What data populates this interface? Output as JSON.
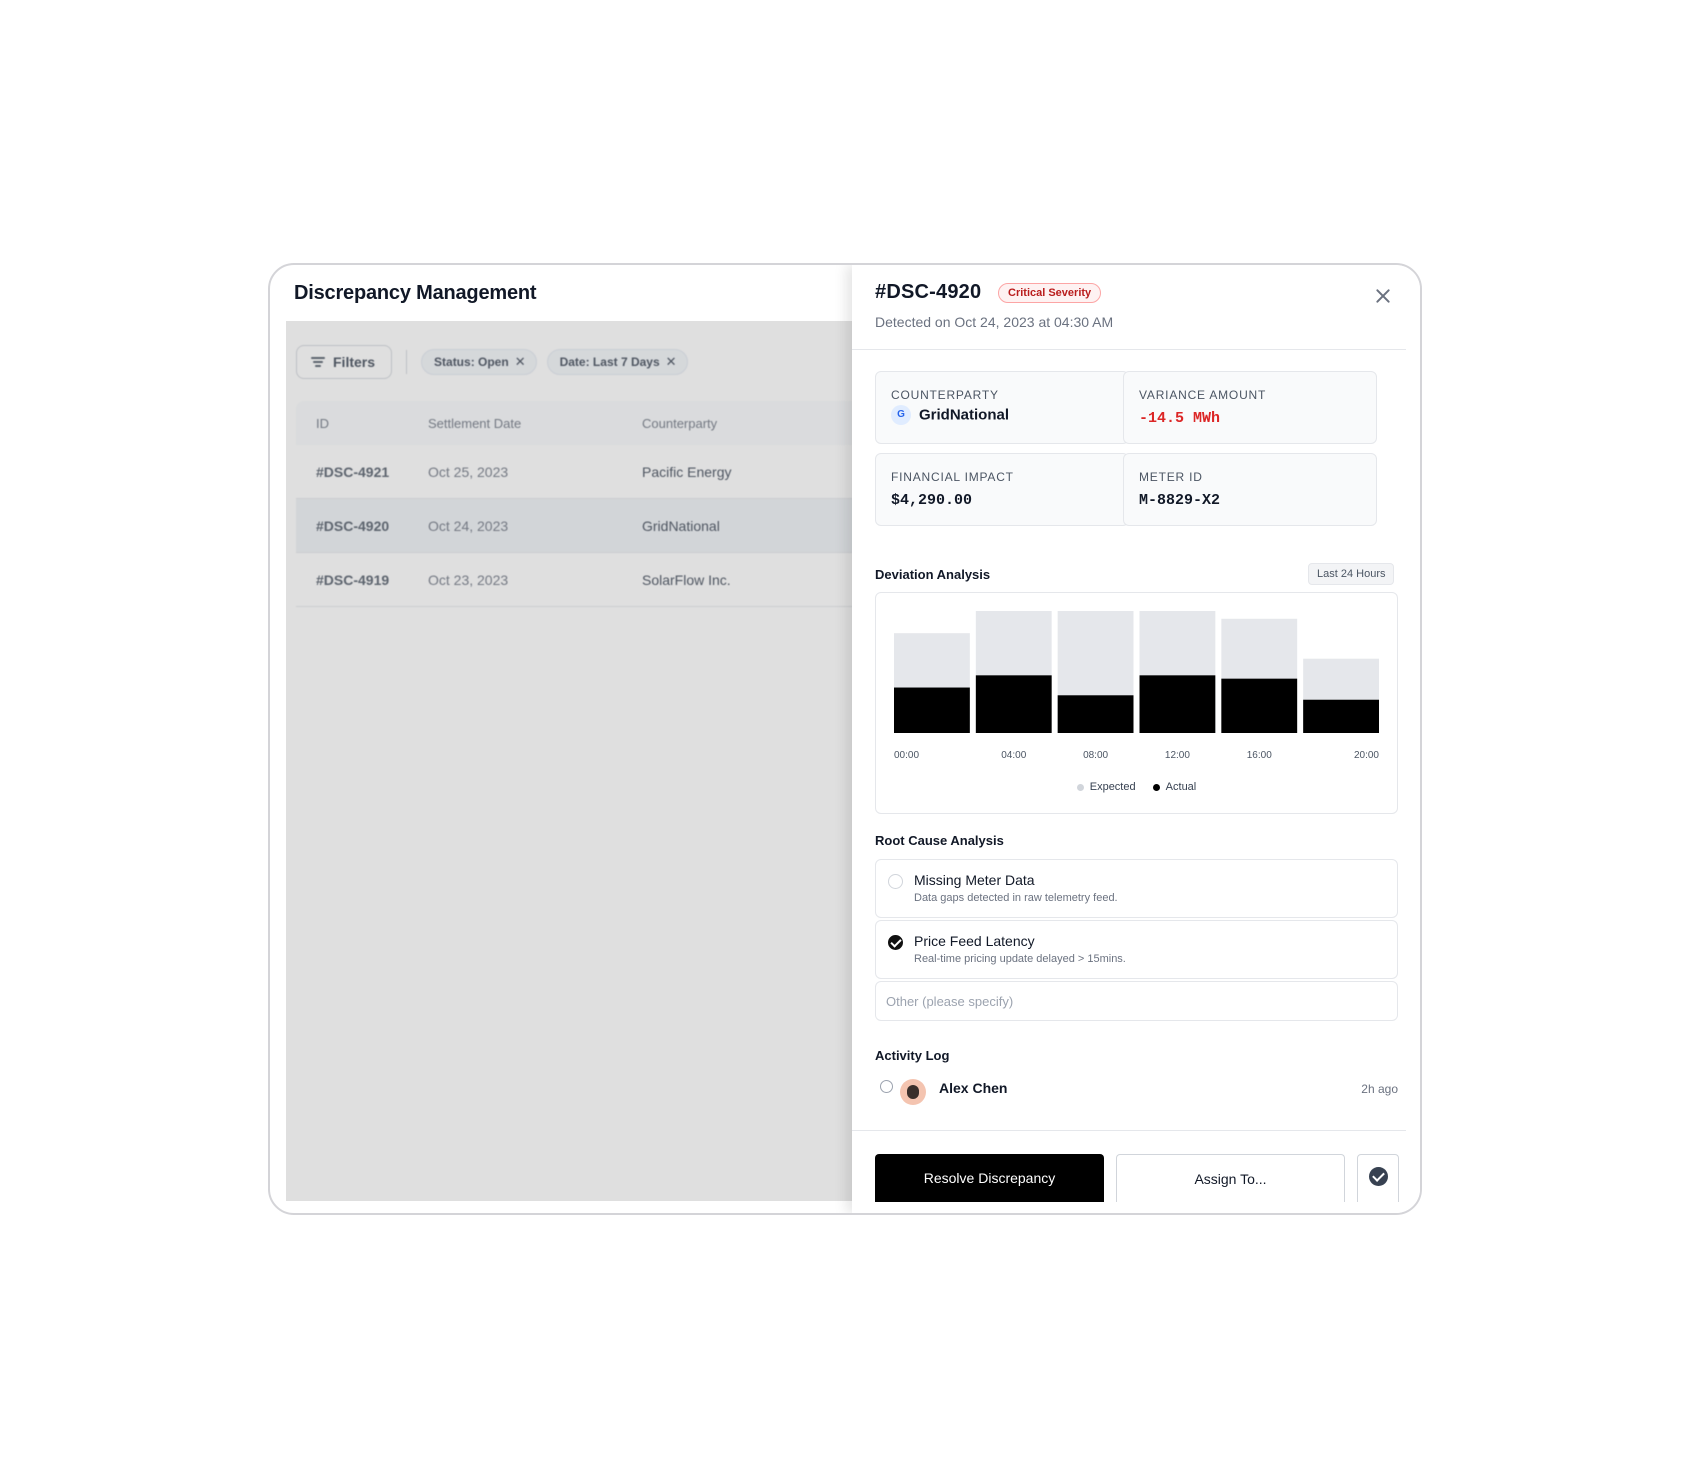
{
  "app": {
    "title": "Discrepancy Management"
  },
  "list": {
    "filters_label": "Filters",
    "chips": [
      {
        "label": "Status: Open"
      },
      {
        "label": "Date: Last 7 Days"
      }
    ],
    "columns": [
      "ID",
      "Settlement Date",
      "Counterparty"
    ],
    "rows": [
      {
        "id": "#DSC-4921",
        "date": "Oct 25, 2023",
        "counterparty": "Pacific Energy",
        "selected": false
      },
      {
        "id": "#DSC-4920",
        "date": "Oct 24, 2023",
        "counterparty": "GridNational",
        "selected": true
      },
      {
        "id": "#DSC-4919",
        "date": "Oct 23, 2023",
        "counterparty": "SolarFlow Inc.",
        "selected": false
      }
    ]
  },
  "detail": {
    "id": "#DSC-4920",
    "severity": "Critical Severity",
    "detected": "Detected on Oct 24, 2023 at 04:30 AM",
    "cards": {
      "counterparty": {
        "label": "COUNTERPARTY",
        "initial": "G",
        "value": "GridNational"
      },
      "variance": {
        "label": "VARIANCE AMOUNT",
        "value": "-14.5 MWh"
      },
      "financial": {
        "label": "FINANCIAL IMPACT",
        "value": "$4,290.00"
      },
      "meter": {
        "label": "METER ID",
        "value": "M-8829-X2"
      }
    },
    "deviation": {
      "title": "Deviation Analysis",
      "range": "Last 24 Hours"
    },
    "root_cause": {
      "title": "Root Cause Analysis",
      "options": [
        {
          "title": "Missing Meter Data",
          "desc": "Data gaps detected in raw telemetry feed.",
          "checked": false
        },
        {
          "title": "Price Feed Latency",
          "desc": "Real-time pricing update delayed > 15mins.",
          "checked": true
        }
      ],
      "other_placeholder": "Other (please specify)",
      "other_value": ""
    },
    "activity": {
      "title": "Activity Log",
      "entries": [
        {
          "user": "Alex Chen",
          "time": "2h ago"
        }
      ]
    },
    "actions": {
      "resolve": "Resolve Discrepancy",
      "assign": "Assign To..."
    }
  },
  "colors": {
    "expected": "#e5e7eb",
    "actual": "#000000",
    "critical": "#dc2626",
    "accent": "#000000"
  },
  "chart_data": {
    "type": "bar",
    "stacked": true,
    "categories": [
      "00:00",
      "04:00",
      "08:00",
      "12:00",
      "16:00",
      "20:00"
    ],
    "series": [
      {
        "name": "Expected",
        "values": [
          90,
          110,
          110,
          110,
          103,
          67
        ]
      },
      {
        "name": "Actual",
        "values": [
          41,
          52,
          34,
          52,
          49,
          30
        ]
      }
    ],
    "ylim": [
      0,
      110
    ],
    "legend": "bottom-center",
    "grid": false,
    "title": "",
    "xlabel": "",
    "ylabel": ""
  }
}
